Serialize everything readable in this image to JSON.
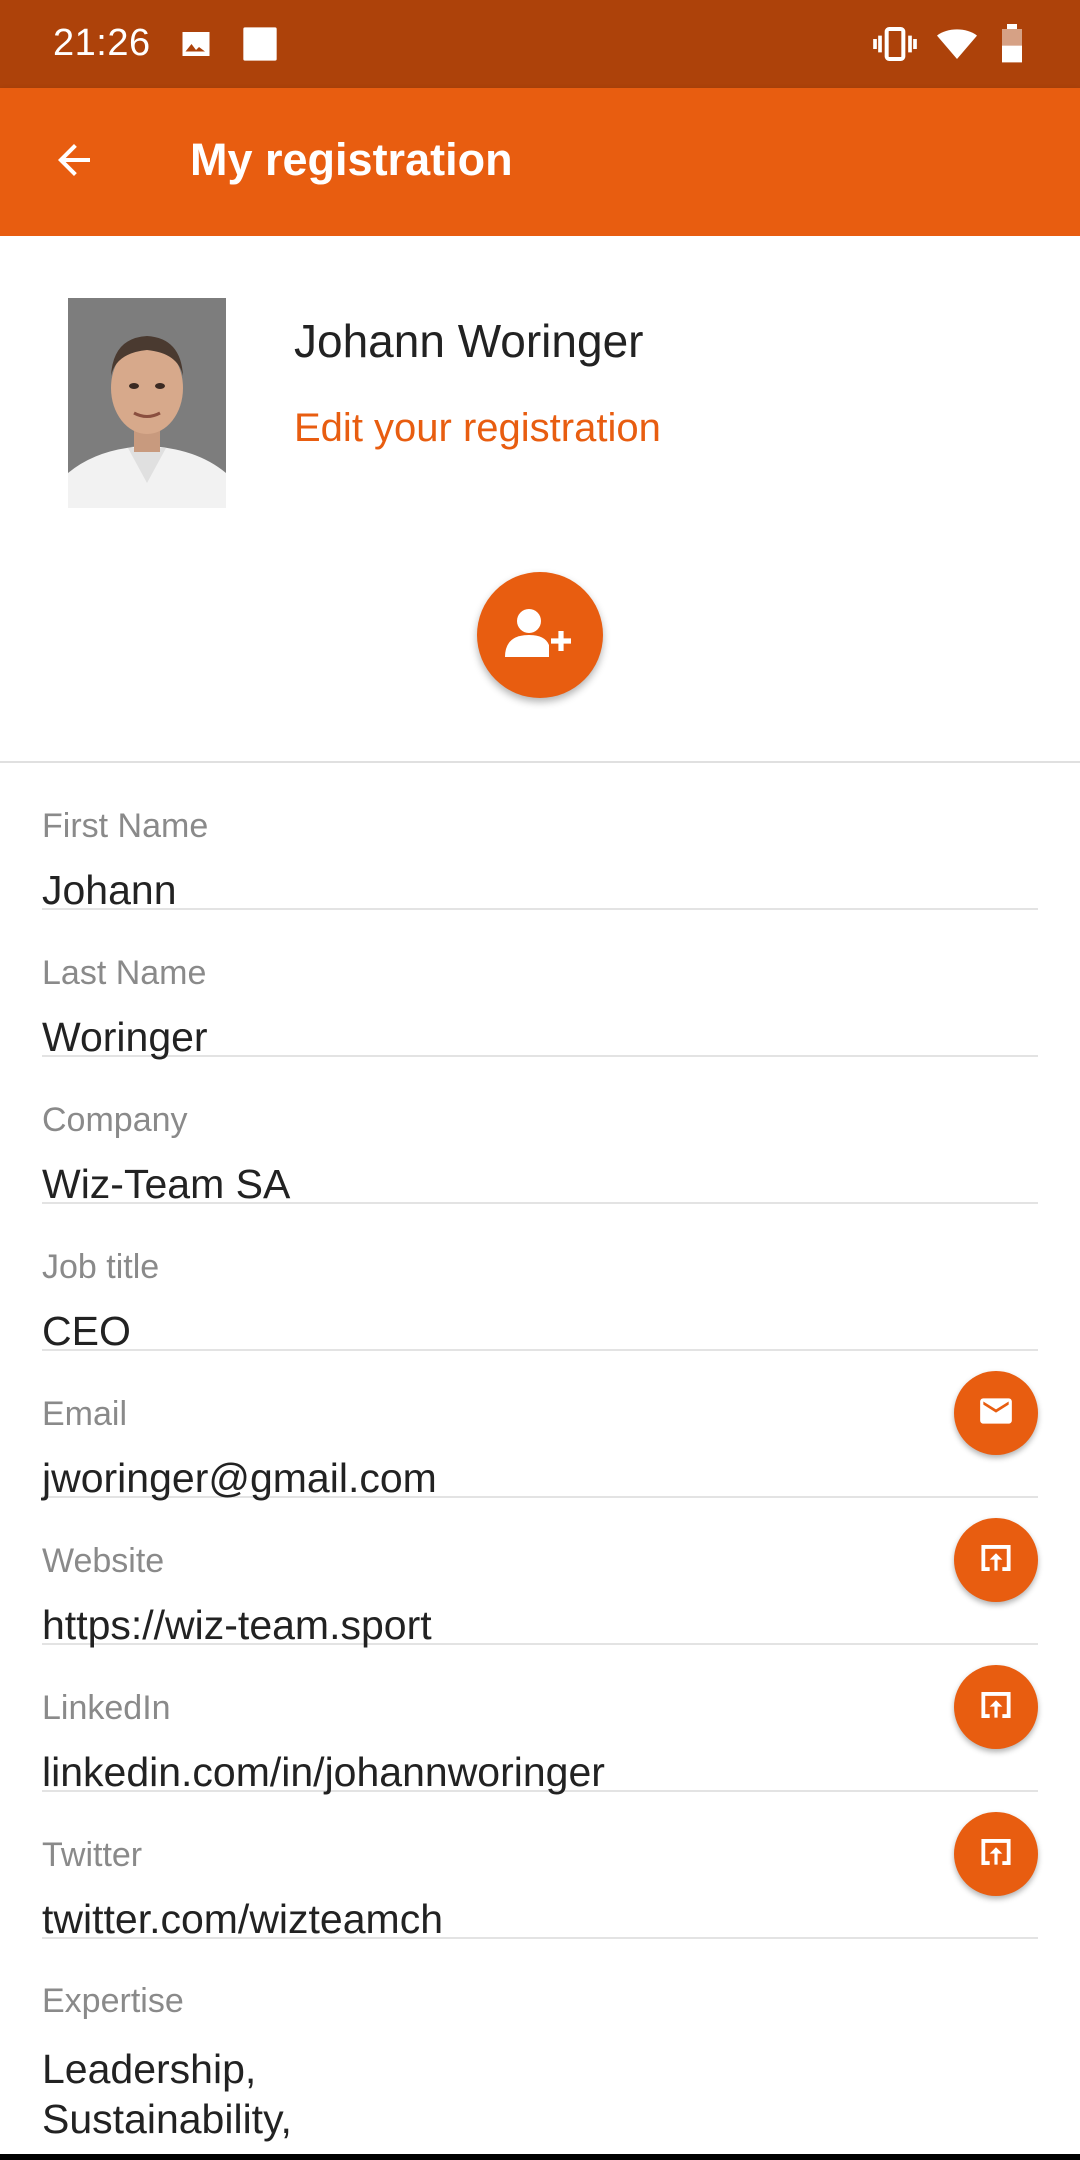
{
  "status_bar": {
    "time": "21:26",
    "left_icons": [
      "image-icon",
      "square-icon"
    ],
    "right_icons": [
      "vibrate-icon",
      "wifi-icon",
      "battery-icon"
    ]
  },
  "app_bar": {
    "title": "My registration",
    "back_icon": "arrow-back-icon"
  },
  "profile": {
    "name": "Johann Woringer",
    "edit_link": "Edit your registration",
    "add_contact_icon": "person-add-icon"
  },
  "fields": [
    {
      "label": "First Name",
      "value": "Johann"
    },
    {
      "label": "Last Name",
      "value": "Woringer"
    },
    {
      "label": "Company",
      "value": "Wiz-Team SA"
    },
    {
      "label": "Job title",
      "value": "CEO"
    },
    {
      "label": "Email",
      "value": "jworinger@gmail.com",
      "action_icon": "mail-icon"
    },
    {
      "label": "Website",
      "value": "https://wiz-team.sport",
      "action_icon": "open-external-icon"
    },
    {
      "label": "LinkedIn",
      "value": "linkedin.com/in/johannworinger",
      "action_icon": "open-external-icon"
    },
    {
      "label": "Twitter",
      "value": "twitter.com/wizteamch",
      "action_icon": "open-external-icon"
    }
  ],
  "expertise": {
    "label": "Expertise",
    "lines": [
      "Leadership,",
      "Sustainability,"
    ]
  },
  "colors": {
    "status_bar": "#ad420a",
    "primary": "#e85d10",
    "label_gray": "#8a8a8a",
    "text": "#222222"
  }
}
